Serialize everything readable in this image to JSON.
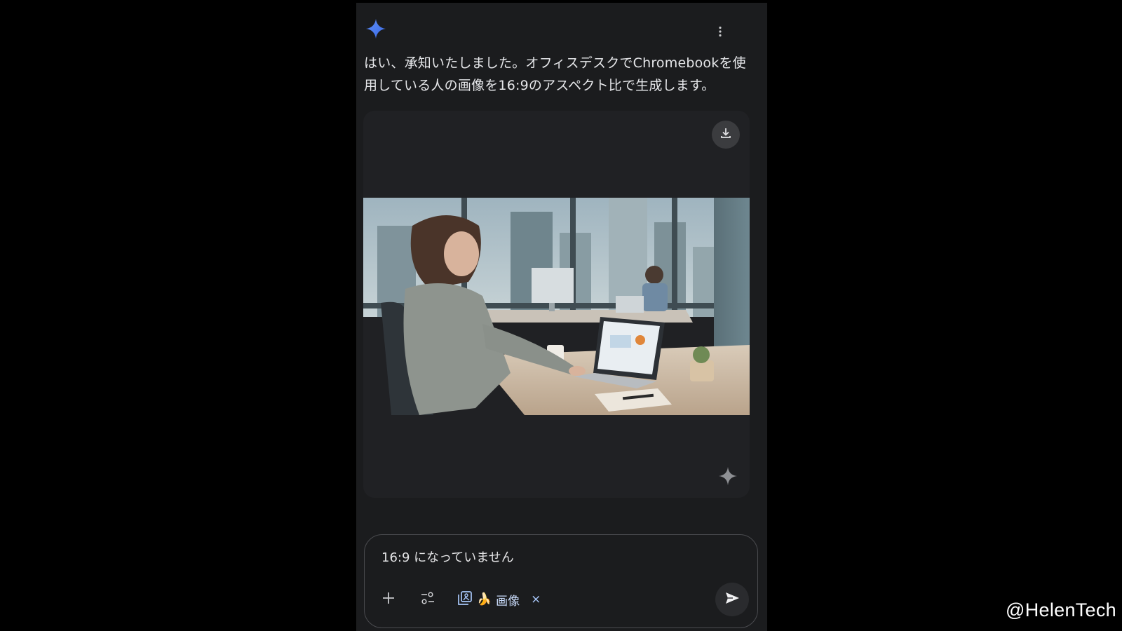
{
  "response": {
    "text": "はい、承知いたしました。オフィスデスクでChromebookを使用している人の画像を16:9のアスペクト比で生成します。"
  },
  "header": {
    "logo_icon": "gemini-sparkle-icon",
    "menu_icon": "more-vert-icon"
  },
  "image_card": {
    "download_icon": "download-icon",
    "watermark_icon": "sparkle-icon"
  },
  "composer": {
    "input_value": "16:9 になっていません",
    "add_icon": "plus-icon",
    "tools_icon": "tune-icon",
    "chip": {
      "icon": "image-gallery-icon",
      "emoji": "🍌",
      "label": "画像",
      "close": "×"
    },
    "send_icon": "send-icon"
  },
  "watermark": "@HelenTech",
  "colors": {
    "background": "#000000",
    "panel": "#1b1c1e",
    "card": "#202124",
    "text": "#e6e7ea",
    "accent": "#a8c7fa",
    "gemini_blue": "#4a7cf0"
  }
}
